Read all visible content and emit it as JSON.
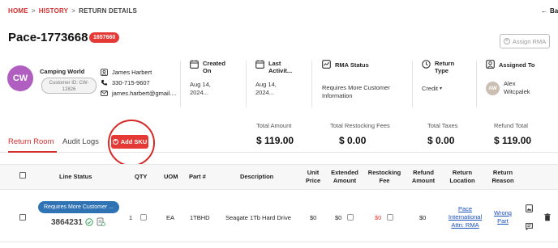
{
  "breadcrumb": {
    "home": "HOME",
    "history": "HISTORY",
    "current": "RETURN DETAILS",
    "sep": ">"
  },
  "back": {
    "label": "Back"
  },
  "header": {
    "title": "Pace-1773668",
    "badge": "1657660",
    "assign_button": "Assign RMA"
  },
  "customer": {
    "initials": "CW",
    "avatar_color": "#b05fc0",
    "name": "Camping World",
    "id_line1": "Customer ID: CW-",
    "id_line2": "12826"
  },
  "contact": {
    "name": "James Harbert",
    "phone": "330-715-9607",
    "email": "james.harbert@gmail...."
  },
  "info": {
    "created_label1": "Created",
    "created_label2": "On",
    "created_val1": "Aug 14,",
    "created_val2": "2024...",
    "activity_label1": "Last",
    "activity_label2": "Activit...",
    "activity_val1": "Aug 14,",
    "activity_val2": "2024...",
    "rma_label": "RMA Status",
    "rma_val1": "Requires More Customer",
    "rma_val2": "Information",
    "return_type_label1": "Return",
    "return_type_label2": "Type",
    "return_type_val": "Credit",
    "assigned_label": "Assigned To",
    "assigned_initials": "AW",
    "assigned_name1": "Alex",
    "assigned_name2": "Witcpalek"
  },
  "totals": {
    "amount_label": "Total Amount",
    "amount": "$ 119.00",
    "restock_label": "Total Restocking Fees",
    "restock": "$ 0.00",
    "taxes_label": "Total Taxes",
    "taxes": "$ 0.00",
    "refund_label": "Refund Total",
    "refund": "$ 119.00"
  },
  "tabs": [
    {
      "label": "Return Room",
      "active": true
    },
    {
      "label": "Audit Logs",
      "active": false
    }
  ],
  "add_sku": "Add SKU",
  "table": {
    "headers": {
      "line_status": "Line Status",
      "qty": "QTY",
      "uom": "UOM",
      "part": "Part #",
      "description": "Description",
      "unit_price1": "Unit",
      "unit_price2": "Price",
      "ext1": "Extended",
      "ext2": "Amount",
      "restock1": "Restocking",
      "restock2": "Fee",
      "refund1": "Refund",
      "refund2": "Amount",
      "loc1": "Return",
      "loc2": "Location",
      "reason1": "Return",
      "reason2": "Reason"
    },
    "row": {
      "status": "Requires More Customer ...",
      "order_id": "3864231",
      "qty": "1",
      "uom": "EA",
      "part": "1TBHD",
      "description": "Seagate 1Tb Hard Drive",
      "unit_price": "$0",
      "ext_amount": "$0",
      "restock_fee": "$0",
      "refund": "$0",
      "location1": "Pace",
      "location2": "International",
      "location3": "Attn: RMA",
      "reason1": "Wrong",
      "reason2": "Part"
    }
  },
  "colors": {
    "accent": "#d32f2f",
    "status_blue": "#2f73b5",
    "link": "#1a4fbf"
  }
}
